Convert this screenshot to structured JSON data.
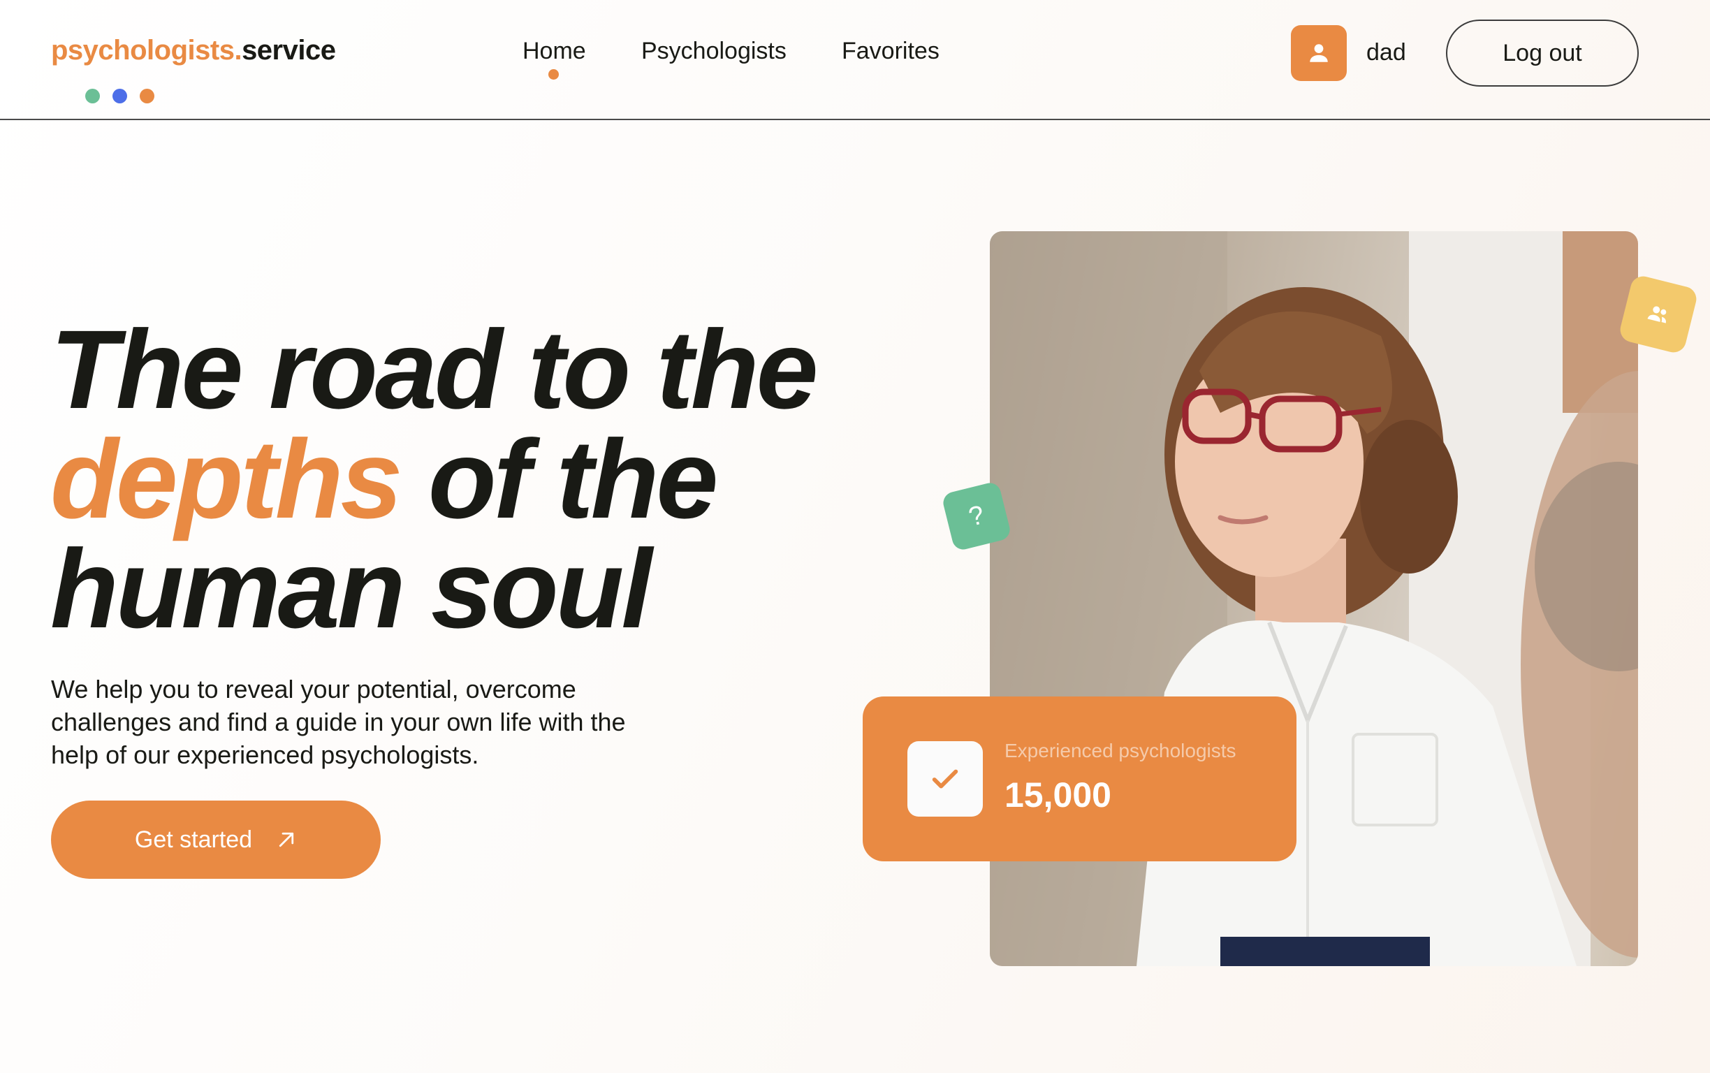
{
  "header": {
    "logo_brand": "psychologists.",
    "logo_suffix": "service",
    "nav": [
      {
        "label": "Home",
        "active": true
      },
      {
        "label": "Psychologists",
        "active": false
      },
      {
        "label": "Favorites",
        "active": false
      }
    ],
    "user": {
      "name": "dad",
      "avatar_icon": "user-icon"
    },
    "logout_label": "Log out"
  },
  "hero": {
    "title_line1": "The road to the",
    "title_accent": "depths",
    "title_line2_rest": " of the",
    "title_line3": "human soul",
    "description": "We help you to reveal your potential, overcome challenges and find a guide in your own life with the help of our experienced psychologists.",
    "cta_label": "Get started",
    "cta_icon": "arrow-up-right-icon"
  },
  "stats": {
    "label": "Experienced psychologists",
    "value": "15,000",
    "icon": "check-icon"
  },
  "badges": {
    "question_symbol": "?",
    "users_icon": "users-icon",
    "question_icon": "question-icon"
  },
  "colors": {
    "accent": "#e98a43",
    "green": "#6bbf96",
    "blue": "#4d6ee8",
    "yellow": "#f3c96c",
    "text": "#191a15"
  }
}
